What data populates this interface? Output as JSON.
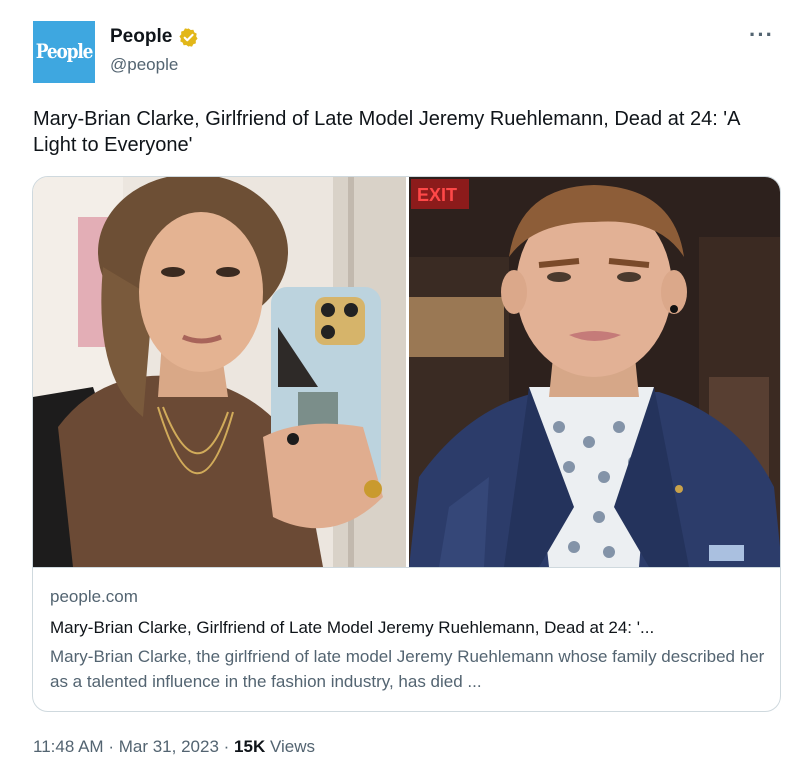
{
  "author": {
    "avatar_text": "People",
    "display_name": "People",
    "handle": "@people",
    "verified": true,
    "verified_color": "#e2b719"
  },
  "more_label": "···",
  "tweet": {
    "text": "Mary-Brian Clarke, Girlfriend of Late Model Jeremy Ruehlemann, Dead at 24: 'A Light to Everyone'"
  },
  "card": {
    "domain": "people.com",
    "title": "Mary-Brian Clarke, Girlfriend of Late Model Jeremy Ruehlemann, Dead at 24: '...",
    "description": "Mary-Brian Clarke, the girlfriend of late model Jeremy Ruehlemann whose family described her as a talented influence in the fashion industry, has died ...",
    "image_left_icon": "woman-selfie-photo",
    "image_right_icon": "man-portrait-photo",
    "exit_sign": "EXIT"
  },
  "footer": {
    "time": "11:48 AM",
    "separator": "·",
    "date": "Mar 31, 2023",
    "views_count": "15K",
    "views_label": "Views"
  },
  "colors": {
    "brand_avatar": "#3ea7e0",
    "secondary_text": "#536471",
    "border": "#cfd9de"
  }
}
